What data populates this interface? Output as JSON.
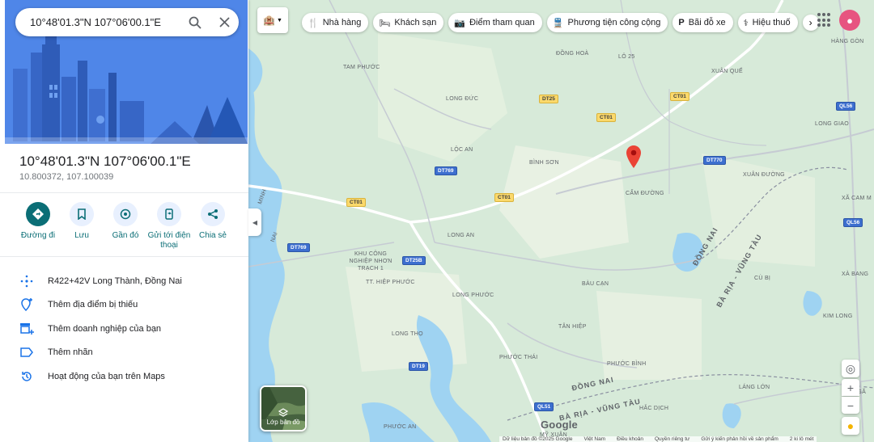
{
  "search": {
    "value": "10°48'01.3\"N 107°06'00.1\"E"
  },
  "place": {
    "title": "10°48'01.3\"N 107°06'00.1\"E",
    "decimal": "10.800372, 107.100039"
  },
  "actions": [
    {
      "label": "Đường đi",
      "icon": "directions-icon"
    },
    {
      "label": "Lưu",
      "icon": "bookmark-icon"
    },
    {
      "label": "Gần đó",
      "icon": "nearby-icon"
    },
    {
      "label": "Gửi tới điện thoại",
      "icon": "phone-send-icon"
    },
    {
      "label": "Chia sẻ",
      "icon": "share-icon"
    }
  ],
  "list": [
    {
      "label": "R422+42V Long Thành, Đồng Nai",
      "icon": "plus-code-icon"
    },
    {
      "label": "Thêm địa điểm bị thiếu",
      "icon": "add-place-icon"
    },
    {
      "label": "Thêm doanh nghiệp của bạn",
      "icon": "add-business-icon"
    },
    {
      "label": "Thêm nhãn",
      "icon": "label-icon"
    },
    {
      "label": "Hoạt động của bạn trên Maps",
      "icon": "history-icon"
    }
  ],
  "chips": [
    {
      "label": "Nhà hàng",
      "icon": "restaurant-icon"
    },
    {
      "label": "Khách sạn",
      "icon": "hotel-icon"
    },
    {
      "label": "Điểm tham quan",
      "icon": "camera-icon"
    },
    {
      "label": "Phương tiện công cộng",
      "icon": "transit-icon"
    },
    {
      "label": "Bãi đỗ xe",
      "icon": "parking-icon"
    },
    {
      "label": "Hiệu thuố",
      "icon": "pharmacy-icon"
    }
  ],
  "map_labels": {
    "tam_phuoc": "TAM PHƯỚC",
    "dong_hoa": "ĐỒNG HOÀ",
    "lo25": "LÔ 25",
    "hang_gon": "HÀNG GÒN",
    "xuan_que": "XUÂN QUẾ",
    "long_duc": "LONG ĐỨC",
    "loc_an": "LỘC AN",
    "binh_son": "BÌNH SƠN",
    "long_giao": "LONG GIAO",
    "xuan_duong": "XUÂN ĐƯỜNG",
    "cam_duong": "CẨM ĐƯỜNG",
    "xa_cam_my": "XÃ CAM M",
    "long_an": "LONG AN",
    "khu_cong_nghiep": "KHU CÔNG NGHIỆP NHƠN TRẠCH 1",
    "hiep_phuoc": "TT. HIỆP PHƯỚC",
    "long_phuoc": "LONG PHƯỚC",
    "bau_can": "BÀU CẠN",
    "cu_bi": "CÙ BỊ",
    "xa_bang": "XÀ BANG",
    "long_tho": "LONG THỌ",
    "tan_hiep": "TÂN HIỆP",
    "kim_long": "KIM LONG",
    "phuoc_thai": "PHƯỚC THÁI",
    "phuoc_binh": "PHƯỚC BÌNH",
    "lang_lon": "LÁNG LỚN",
    "hac_dich": "HẮC DỊCH",
    "phuoc_an": "PHƯỚC AN",
    "my_xuan": "MỸ XUÂN",
    "nga": "NGÃ",
    "minh": "MINH",
    "nai": "NAI",
    "dong_nai_region": "ĐỒNG NAI",
    "bria_region": "BÀ RỊA - VŨNG TÀU",
    "dong_nai_region2": "ĐỒNG NAI",
    "bria_region2": "BÀ RỊA - VŨNG TÀU"
  },
  "road_shields": {
    "dt25": "DT25",
    "ct01_a": "CT01",
    "ct01_b": "CT01",
    "ct01_c": "CT01",
    "ct01_d": "CT01",
    "dt769_a": "DT769",
    "dt769_b": "DT769",
    "dt770": "DT770",
    "ql56_a": "QL56",
    "ql56_b": "QL56",
    "dt25b": "DT25B",
    "dt19": "DT19",
    "ql51": "QL51"
  },
  "layer_button": {
    "label": "Lớp bản đồ"
  },
  "footer": {
    "data": "Dữ liệu bản đồ ©2025 Google",
    "vietnam": "Việt Nam",
    "terms": "Điều khoản",
    "privacy": "Quyền riêng tư",
    "feedback": "Gửi ý kiến phản hồi về sản phẩm",
    "scale": "2 ki lô mét"
  },
  "google_logo": "Google",
  "colors": {
    "accent": "#0b6e76",
    "map_green": "#d7ead9",
    "water": "#9fd3f2",
    "pin": "#ea4335"
  }
}
